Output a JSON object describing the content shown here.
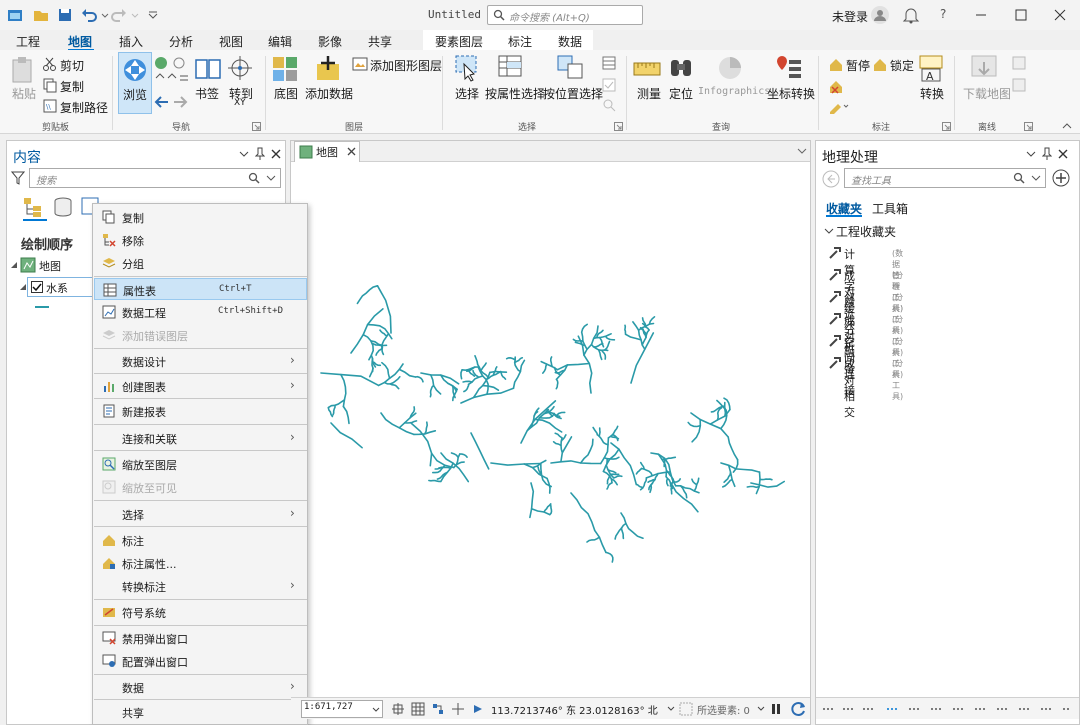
{
  "window": {
    "doc_title": "Untitled",
    "command_search_placeholder": "命令搜索 (Alt+Q)",
    "user_label": "未登录",
    "help_label": "?"
  },
  "tabs": [
    "工程",
    "地图",
    "插入",
    "分析",
    "视图",
    "编辑",
    "影像",
    "共享"
  ],
  "context_tabs": [
    "要素图层",
    "标注",
    "数据"
  ],
  "ribbon": {
    "clipboard": {
      "paste": "粘贴",
      "cut": "剪切",
      "copy": "复制",
      "copy_path": "复制路径",
      "group": "剪贴板"
    },
    "navigate": {
      "explore": "浏览",
      "bookmarks": "书签",
      "goto_xy": "转到",
      "goto_xy_sub": "XY",
      "group": "导航"
    },
    "layer": {
      "basemap": "底图",
      "add_data": "添加数据",
      "add_graphics": "添加图形图层",
      "group": "图层"
    },
    "selection": {
      "select": "选择",
      "by_attr": "按属性选择",
      "by_loc": "按位置选择",
      "group": "选择"
    },
    "inquiry": {
      "measure": "测量",
      "locate": "定位",
      "infographics": "Infographics",
      "convert_coord": "坐标转换",
      "group": "查询"
    },
    "labeling": {
      "pause": "暂停",
      "lock": "锁定",
      "convert": "转换",
      "group": "标注"
    },
    "offline": {
      "download_map": "下载地图",
      "group": "离线"
    }
  },
  "contents": {
    "title": "内容",
    "search_placeholder": "搜索",
    "drawing_order": "绘制顺序",
    "map_label": "地图",
    "layer_label": "水系"
  },
  "map_tab": {
    "label": "地图"
  },
  "context_menu": [
    {
      "label": "复制",
      "icon": "copy-icon"
    },
    {
      "label": "移除",
      "icon": "remove-icon"
    },
    {
      "label": "分组",
      "icon": "group-icon"
    },
    {
      "label": "属性表",
      "shortcut": "Ctrl+T",
      "icon": "table-icon",
      "highlighted": true
    },
    {
      "label": "数据工程",
      "shortcut": "Ctrl+Shift+D",
      "icon": "data-engineering-icon"
    },
    {
      "label": "添加错误图层",
      "icon": "error-layer-icon",
      "disabled": true
    },
    {
      "label": "数据设计",
      "submenu": true
    },
    {
      "label": "创建图表",
      "icon": "chart-icon",
      "submenu": true
    },
    {
      "label": "新建报表",
      "icon": "report-icon"
    },
    {
      "label": "连接和关联",
      "submenu": true
    },
    {
      "label": "缩放至图层",
      "icon": "zoom-layer-icon"
    },
    {
      "label": "缩放至可见",
      "icon": "zoom-visible-icon",
      "disabled": true
    },
    {
      "label": "选择",
      "submenu": true
    },
    {
      "label": "标注",
      "icon": "label-icon"
    },
    {
      "label": "标注属性...",
      "icon": "label-properties-icon"
    },
    {
      "label": "转换标注",
      "submenu": true
    },
    {
      "label": "符号系统",
      "icon": "symbology-icon"
    },
    {
      "label": "禁用弹出窗口",
      "icon": "disable-popup-icon"
    },
    {
      "label": "配置弹出窗口",
      "icon": "configure-popup-icon"
    },
    {
      "label": "数据",
      "submenu": true
    },
    {
      "label": "共享",
      "submenu": true
    }
  ],
  "statusbar": {
    "scale": "1:671,727",
    "coordinates": "113.7213746° 东 23.0128163° 北",
    "selected_features": "所选要素: 0"
  },
  "geoprocessing": {
    "title": "地理处理",
    "search_placeholder": "查找工具",
    "tab_favorites": "收藏夹",
    "tab_toolboxes": "工具箱",
    "project_favorites": "工程收藏夹",
    "tools": [
      {
        "name": "计算字段",
        "source": "(数据管理工具)"
      },
      {
        "name": "成对缓冲",
        "source": "(分析工具)"
      },
      {
        "name": "邻近分析",
        "source": "(分析工具)"
      },
      {
        "name": "成对融合",
        "source": "(分析工具)"
      },
      {
        "name": "空间连接",
        "source": "(分析工具)"
      },
      {
        "name": "成对相交",
        "source": "(分析工具)"
      }
    ]
  },
  "colors": {
    "accent": "#0078d4",
    "river": "#2a9aa8",
    "highlight": "#cce4f7"
  }
}
